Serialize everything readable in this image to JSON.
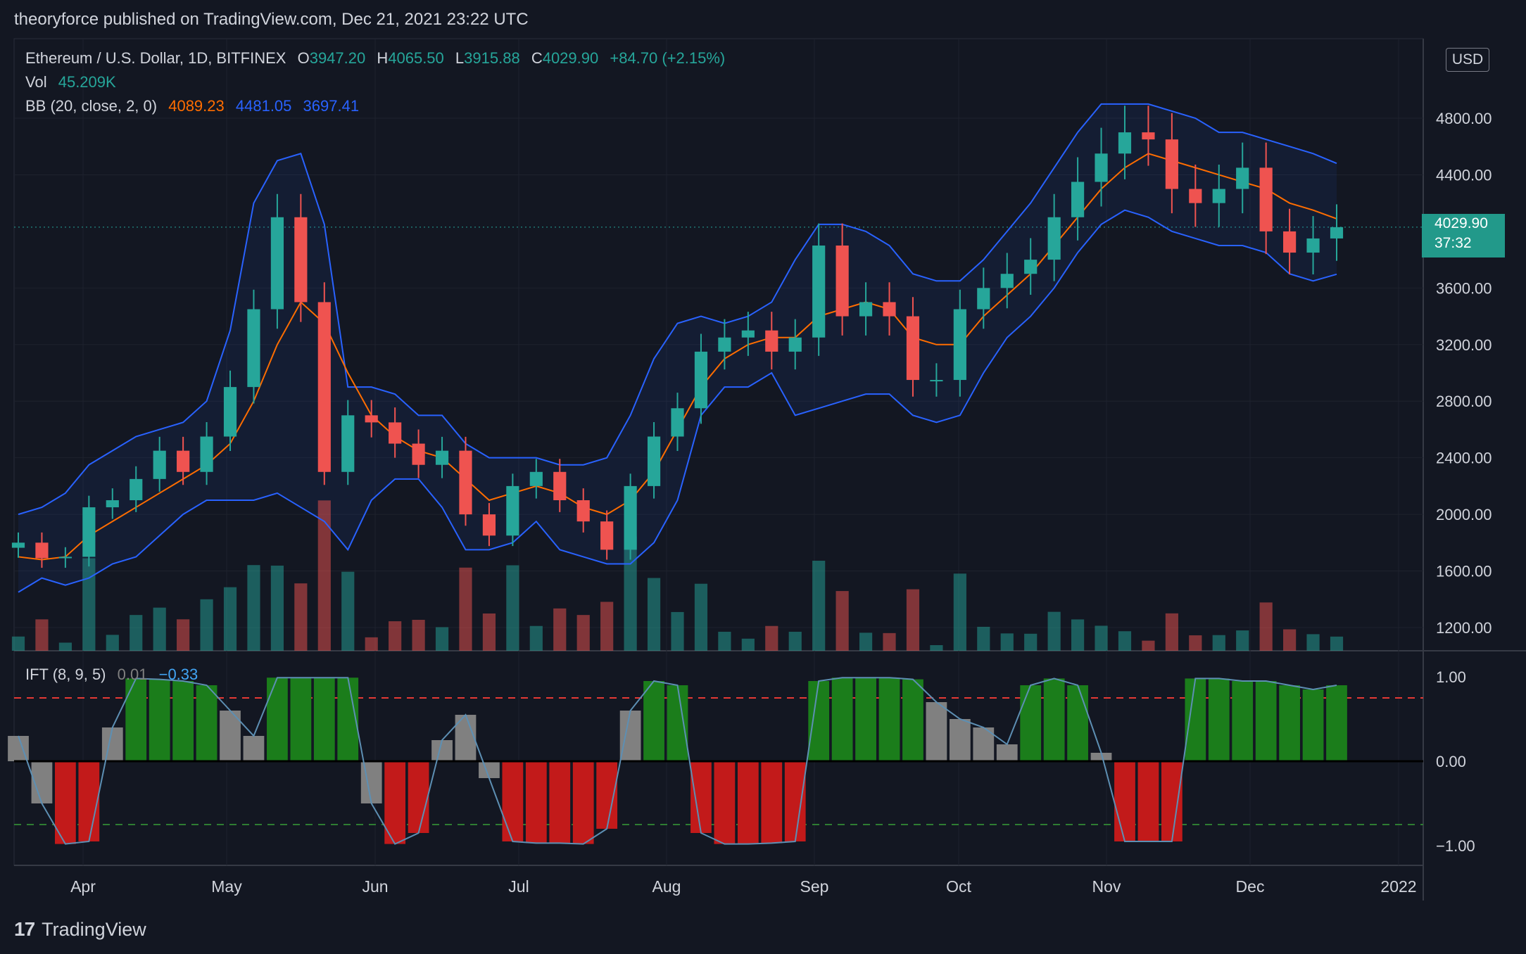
{
  "header": {
    "text": "theoryforce published on TradingView.com, Dec 21, 2021 23:22 UTC"
  },
  "legend": {
    "symbol": "Ethereum / U.S. Dollar, 1D, BITFINEX",
    "o_label": "O",
    "o_value": "3947.20",
    "h_label": "H",
    "h_value": "4065.50",
    "l_label": "L",
    "l_value": "3915.88",
    "c_label": "C",
    "c_value": "4029.90",
    "change": "+84.70 (+2.15%)",
    "vol_label": "Vol",
    "vol_value": "45.209K",
    "bb_label": "BB (20, close, 2, 0)",
    "bb_basis": "4089.23",
    "bb_upper": "4481.05",
    "bb_lower": "3697.41",
    "ift_label": "IFT (8, 9, 5)",
    "ift_v1": "0.01",
    "ift_v2": "−0.33"
  },
  "price_scale": {
    "currency_button": "USD",
    "current_price": "4029.90",
    "countdown": "37:32"
  },
  "colors": {
    "background": "#131722",
    "up": "#26a69a",
    "down": "#ef5350",
    "bb_band": "#2962ff",
    "bb_basis": "#ff6d00",
    "ift_green": "#1b7d1b",
    "ift_red": "#c21a1a",
    "ift_gray": "#808080"
  },
  "footer": {
    "brand": "TradingView",
    "logo": "17"
  },
  "chart_data": [
    {
      "type": "candlestick",
      "title": "Ethereum / U.S. Dollar, 1D, BITFINEX",
      "x_tick_labels": [
        "Apr",
        "May",
        "Jun",
        "Jul",
        "Aug",
        "Sep",
        "Oct",
        "Nov",
        "Dec",
        "2022"
      ],
      "y_tick_labels": [
        "4800.00",
        "4400.00",
        "3600.00",
        "3200.00",
        "2800.00",
        "2400.00",
        "2000.00",
        "1600.00",
        "1200.00"
      ],
      "ylim": [
        1040,
        5200
      ],
      "x": [
        "Mar 18",
        "Mar 23",
        "Mar 28",
        "Apr 2",
        "Apr 7",
        "Apr 12",
        "Apr 17",
        "Apr 22",
        "Apr 27",
        "May 2",
        "May 7",
        "May 12",
        "May 17",
        "May 22",
        "May 27",
        "Jun 1",
        "Jun 6",
        "Jun 11",
        "Jun 16",
        "Jun 21",
        "Jun 26",
        "Jul 1",
        "Jul 6",
        "Jul 11",
        "Jul 16",
        "Jul 21",
        "Jul 26",
        "Jul 31",
        "Aug 5",
        "Aug 10",
        "Aug 15",
        "Aug 20",
        "Aug 25",
        "Aug 30",
        "Sep 4",
        "Sep 9",
        "Sep 14",
        "Sep 19",
        "Sep 24",
        "Sep 29",
        "Oct 4",
        "Oct 9",
        "Oct 14",
        "Oct 19",
        "Oct 24",
        "Oct 29",
        "Nov 3",
        "Nov 8",
        "Nov 13",
        "Nov 18",
        "Nov 23",
        "Nov 28",
        "Dec 3",
        "Dec 8",
        "Dec 13",
        "Dec 18",
        "Dec 21"
      ],
      "close": [
        1800,
        1690,
        1700,
        2050,
        2100,
        2250,
        2450,
        2300,
        2550,
        2900,
        3450,
        4100,
        3500,
        2300,
        2700,
        2650,
        2500,
        2350,
        2450,
        2000,
        1850,
        2200,
        2300,
        2100,
        1950,
        1750,
        2200,
        2550,
        2750,
        3150,
        3250,
        3300,
        3150,
        3250,
        3900,
        3400,
        3500,
        3400,
        2950,
        2950,
        3450,
        3600,
        3700,
        3800,
        4100,
        4350,
        4550,
        4700,
        4650,
        4300,
        4200,
        4300,
        4450,
        4000,
        3850,
        3950,
        4030
      ],
      "series": [
        {
          "name": "BB basis",
          "values": [
            1700,
            1680,
            1700,
            1850,
            1950,
            2050,
            2150,
            2250,
            2350,
            2500,
            2800,
            3200,
            3500,
            3350,
            3000,
            2700,
            2550,
            2450,
            2400,
            2250,
            2100,
            2150,
            2200,
            2150,
            2050,
            2000,
            2100,
            2300,
            2600,
            2900,
            3100,
            3200,
            3250,
            3250,
            3400,
            3450,
            3500,
            3450,
            3250,
            3200,
            3200,
            3400,
            3550,
            3700,
            3900,
            4100,
            4300,
            4450,
            4550,
            4500,
            4450,
            4400,
            4350,
            4300,
            4200,
            4150,
            4089
          ]
        },
        {
          "name": "BB upper",
          "values": [
            2000,
            2050,
            2150,
            2350,
            2450,
            2550,
            2600,
            2650,
            2800,
            3300,
            4200,
            4500,
            4550,
            4050,
            2900,
            2900,
            2850,
            2700,
            2700,
            2500,
            2400,
            2400,
            2400,
            2350,
            2350,
            2400,
            2700,
            3100,
            3350,
            3400,
            3350,
            3400,
            3500,
            3800,
            4050,
            4050,
            4000,
            3900,
            3700,
            3650,
            3650,
            3800,
            4000,
            4200,
            4450,
            4700,
            4900,
            4900,
            4900,
            4850,
            4800,
            4700,
            4700,
            4650,
            4600,
            4550,
            4481
          ]
        },
        {
          "name": "BB lower",
          "values": [
            1450,
            1550,
            1500,
            1550,
            1650,
            1700,
            1850,
            2000,
            2100,
            2100,
            2100,
            2150,
            2050,
            1950,
            1750,
            2100,
            2250,
            2250,
            2050,
            1750,
            1750,
            1800,
            1950,
            1750,
            1700,
            1650,
            1650,
            1800,
            2100,
            2700,
            2900,
            2900,
            3000,
            2700,
            2750,
            2800,
            2850,
            2850,
            2700,
            2650,
            2700,
            3000,
            3250,
            3400,
            3600,
            3850,
            4050,
            4150,
            4100,
            4000,
            3950,
            3900,
            3900,
            3850,
            3700,
            3650,
            3697
          ]
        }
      ]
    },
    {
      "type": "bar",
      "title": "IFT (8, 9, 5)",
      "y_tick_labels": [
        "1.00",
        "0.00",
        "−1.00"
      ],
      "ylim": [
        -1.25,
        1.25
      ],
      "thresholds": [
        0.75,
        -0.75
      ],
      "x": [
        "Mar 18",
        "Mar 23",
        "Mar 28",
        "Apr 2",
        "Apr 7",
        "Apr 12",
        "Apr 17",
        "Apr 22",
        "Apr 27",
        "May 2",
        "May 7",
        "May 12",
        "May 17",
        "May 22",
        "May 27",
        "Jun 1",
        "Jun 6",
        "Jun 11",
        "Jun 16",
        "Jun 21",
        "Jun 26",
        "Jul 1",
        "Jul 6",
        "Jul 11",
        "Jul 16",
        "Jul 21",
        "Jul 26",
        "Jul 31",
        "Aug 5",
        "Aug 10",
        "Aug 15",
        "Aug 20",
        "Aug 25",
        "Aug 30",
        "Sep 4",
        "Sep 9",
        "Sep 14",
        "Sep 19",
        "Sep 24",
        "Sep 29",
        "Oct 4",
        "Oct 9",
        "Oct 14",
        "Oct 19",
        "Oct 24",
        "Oct 29",
        "Nov 3",
        "Nov 8",
        "Nov 13",
        "Nov 18",
        "Nov 23",
        "Nov 28",
        "Dec 3",
        "Dec 8",
        "Dec 13",
        "Dec 18",
        "Dec 21"
      ],
      "values": [
        0.3,
        -0.5,
        -0.98,
        -0.95,
        0.4,
        0.98,
        0.97,
        0.95,
        0.9,
        0.6,
        0.3,
        0.99,
        0.99,
        0.99,
        0.99,
        -0.5,
        -0.98,
        -0.85,
        0.25,
        0.55,
        -0.2,
        -0.95,
        -0.97,
        -0.97,
        -0.98,
        -0.8,
        0.6,
        0.95,
        0.9,
        -0.85,
        -0.98,
        -0.98,
        -0.97,
        -0.95,
        0.95,
        0.99,
        0.99,
        0.99,
        0.97,
        0.7,
        0.5,
        0.4,
        0.2,
        0.9,
        0.98,
        0.9,
        0.1,
        -0.95,
        -0.95,
        -0.95,
        0.98,
        0.98,
        0.95,
        0.95,
        0.9,
        0.85,
        0.9
      ]
    }
  ]
}
